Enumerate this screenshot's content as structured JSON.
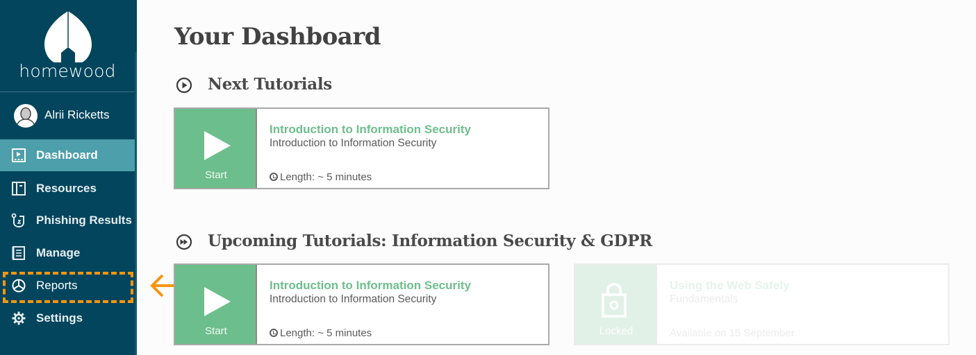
{
  "brand": {
    "name": "homewood"
  },
  "user": {
    "name": "Alrii Ricketts"
  },
  "sidebar": {
    "items": [
      {
        "label": "Dashboard",
        "icon": "dashboard-icon",
        "active": true
      },
      {
        "label": "Resources",
        "icon": "book-icon",
        "active": false
      },
      {
        "label": "Phishing Results",
        "icon": "phishing-hook-icon",
        "active": false
      },
      {
        "label": "Manage",
        "icon": "list-icon",
        "active": false
      },
      {
        "label": "Reports",
        "icon": "pie-chart-icon",
        "active": false,
        "highlighted": true
      },
      {
        "label": "Settings",
        "icon": "gear-icon",
        "active": false
      }
    ]
  },
  "main": {
    "title": "Your Dashboard",
    "sections": [
      {
        "heading": "Next Tutorials",
        "icon": "play-circle-icon",
        "cards": [
          {
            "title": "Introduction to Information Security",
            "subtitle": "Introduction to Information Security",
            "meta": "Length: ~ 5 minutes",
            "action": "Start",
            "locked": false
          }
        ]
      },
      {
        "heading": "Upcoming Tutorials: Information Security & GDPR",
        "icon": "fast-forward-circle-icon",
        "cards": [
          {
            "title": "Introduction to Information Security",
            "subtitle": "Introduction to Information Security",
            "meta": "Length: ~ 5 minutes",
            "action": "Start",
            "locked": false
          },
          {
            "title": "Using the Web Safely",
            "subtitle": "Fundamentals",
            "meta": "Available on 15 September",
            "action": "Locked",
            "locked": true
          }
        ]
      }
    ]
  },
  "colors": {
    "sidebar_bg": "#02455d",
    "active_item_bg": "#4c9fab",
    "accent_green": "#6dbe8d",
    "annotation_orange": "#f7950f"
  }
}
